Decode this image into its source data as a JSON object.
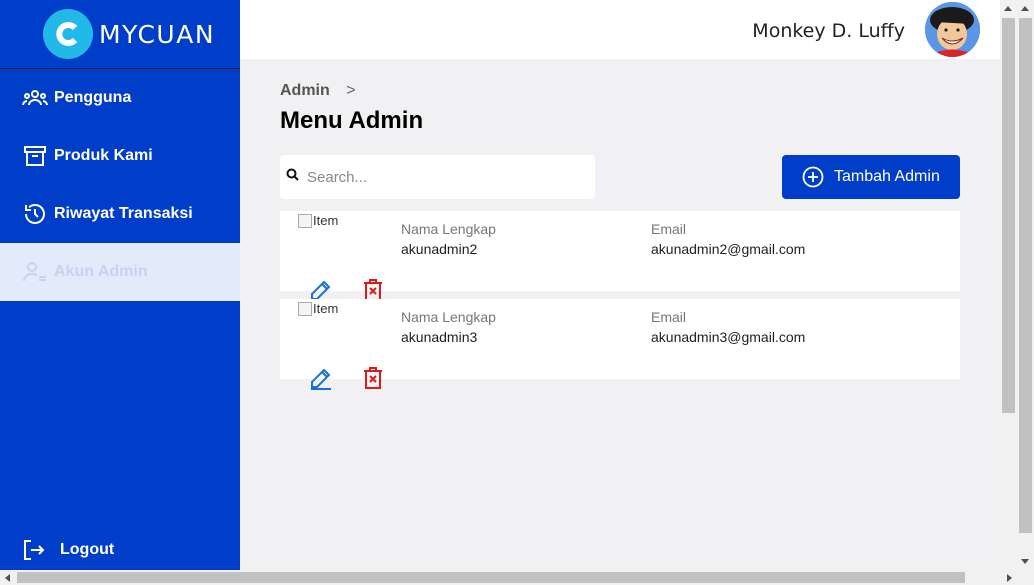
{
  "brand": {
    "name": "MYCUAN",
    "accent": "#003dc9",
    "logo_color": "#22b8e8"
  },
  "sidebar": {
    "items": [
      {
        "label": "Pengguna",
        "icon": "users-icon",
        "active": false
      },
      {
        "label": "Produk Kami",
        "icon": "archive-box-icon",
        "active": false
      },
      {
        "label": "Riwayat Transaksi",
        "icon": "history-clock-icon",
        "active": false
      },
      {
        "label": "Akun Admin",
        "icon": "user-cog-icon",
        "active": true
      }
    ],
    "logout_label": "Logout"
  },
  "header": {
    "user_name": "Monkey D. Luffy"
  },
  "main": {
    "breadcrumb": {
      "item": "Admin",
      "separator": ">"
    },
    "title": "Menu Admin",
    "search": {
      "placeholder": "Search...",
      "value": ""
    },
    "add_button_label": "Tambah Admin",
    "admins": [
      {
        "image_alt": "Item",
        "name_label": "Nama Lengkap",
        "name": "akunadmin2",
        "email_label": "Email",
        "email": "akunadmin2@gmail.com"
      },
      {
        "image_alt": "Item",
        "name_label": "Nama Lengkap",
        "name": "akunadmin3",
        "email_label": "Email",
        "email": "akunadmin3@gmail.com"
      }
    ]
  },
  "colors": {
    "edit": "#1a6fd8",
    "delete": "#e01818"
  }
}
